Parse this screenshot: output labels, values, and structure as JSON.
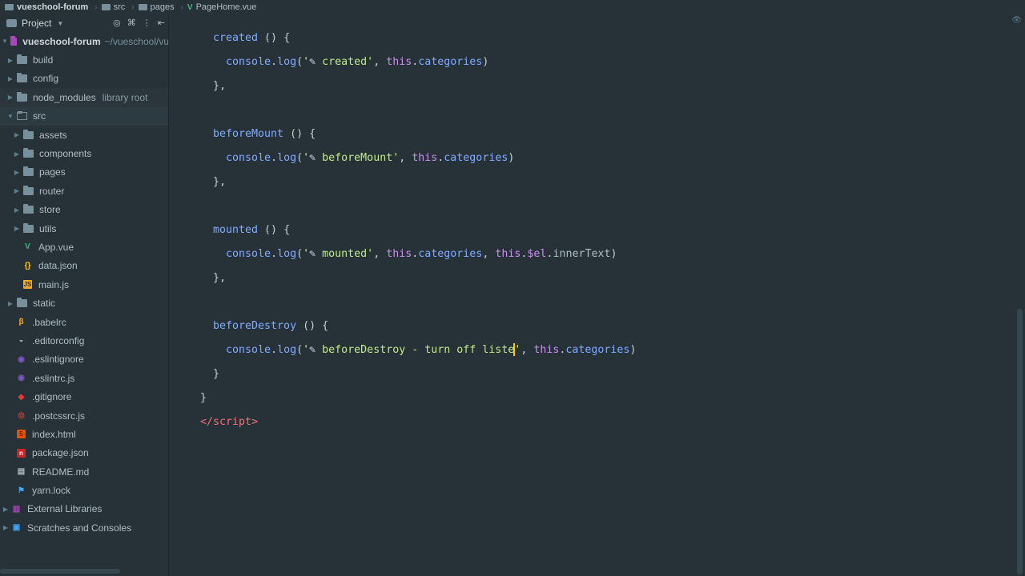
{
  "breadcrumb": [
    "vueschool-forum",
    "src",
    "pages",
    "PageHome.vue"
  ],
  "sidebar": {
    "header": "Project",
    "root": {
      "name": "vueschool-forum",
      "path": "~/vueschool/vu"
    },
    "items": [
      {
        "label": "build",
        "type": "folder",
        "depth": 1
      },
      {
        "label": "config",
        "type": "folder",
        "depth": 1
      },
      {
        "label": "node_modules",
        "extra": "library root",
        "type": "folder",
        "depth": 1
      },
      {
        "label": "src",
        "type": "folder-open",
        "depth": 1
      },
      {
        "label": "assets",
        "type": "folder",
        "depth": 2
      },
      {
        "label": "components",
        "type": "folder",
        "depth": 2
      },
      {
        "label": "pages",
        "type": "folder",
        "depth": 2
      },
      {
        "label": "router",
        "type": "folder",
        "depth": 2
      },
      {
        "label": "store",
        "type": "folder",
        "depth": 2
      },
      {
        "label": "utils",
        "type": "folder",
        "depth": 2
      },
      {
        "label": "App.vue",
        "type": "vue",
        "depth": 2
      },
      {
        "label": "data.json",
        "type": "json",
        "depth": 2
      },
      {
        "label": "main.js",
        "type": "js",
        "depth": 2
      },
      {
        "label": "static",
        "type": "folder",
        "depth": 1
      },
      {
        "label": ".babelrc",
        "type": "babel",
        "depth": 1
      },
      {
        "label": ".editorconfig",
        "type": "editorconfig",
        "depth": 1
      },
      {
        "label": ".eslintignore",
        "type": "eslint",
        "depth": 1
      },
      {
        "label": ".eslintrc.js",
        "type": "eslint",
        "depth": 1
      },
      {
        "label": ".gitignore",
        "type": "git",
        "depth": 1
      },
      {
        "label": ".postcssrc.js",
        "type": "postcss",
        "depth": 1
      },
      {
        "label": "index.html",
        "type": "html",
        "depth": 1
      },
      {
        "label": "package.json",
        "type": "npm",
        "depth": 1
      },
      {
        "label": "README.md",
        "type": "md",
        "depth": 1
      },
      {
        "label": "yarn.lock",
        "type": "yarn",
        "depth": 1
      },
      {
        "label": "External Libraries",
        "type": "lib",
        "depth": 0
      },
      {
        "label": "Scratches and Consoles",
        "type": "scratch",
        "depth": 0
      }
    ]
  },
  "editor": {
    "file": "PageHome.vue",
    "lines": [
      {
        "row": 1,
        "indent": 4,
        "tokens": [
          [
            "fn",
            "created"
          ],
          [
            "p",
            " () {"
          ]
        ]
      },
      {
        "row": 2,
        "indent": 6,
        "tokens": [
          [
            "fn",
            "console"
          ],
          [
            "p",
            "."
          ],
          [
            "fn",
            "log"
          ],
          [
            "p",
            "("
          ],
          [
            "str",
            "'"
          ],
          [
            "feather",
            "✎"
          ],
          [
            "str",
            " created'"
          ],
          [
            "p",
            ", "
          ],
          [
            "kw",
            "this"
          ],
          [
            "p",
            "."
          ],
          [
            "fn",
            "categories"
          ],
          [
            "p",
            ")"
          ]
        ]
      },
      {
        "row": 3,
        "indent": 4,
        "tokens": [
          [
            "p",
            "},"
          ]
        ]
      },
      {
        "row": 5,
        "indent": 4,
        "tokens": [
          [
            "fn",
            "beforeMount"
          ],
          [
            "p",
            " () {"
          ]
        ]
      },
      {
        "row": 6,
        "indent": 6,
        "tokens": [
          [
            "fn",
            "console"
          ],
          [
            "p",
            "."
          ],
          [
            "fn",
            "log"
          ],
          [
            "p",
            "("
          ],
          [
            "str",
            "'"
          ],
          [
            "feather",
            "✎"
          ],
          [
            "str",
            " beforeMount'"
          ],
          [
            "p",
            ", "
          ],
          [
            "kw",
            "this"
          ],
          [
            "p",
            "."
          ],
          [
            "fn",
            "categories"
          ],
          [
            "p",
            ")"
          ]
        ]
      },
      {
        "row": 7,
        "indent": 4,
        "tokens": [
          [
            "p",
            "},"
          ]
        ]
      },
      {
        "row": 9,
        "indent": 4,
        "tokens": [
          [
            "fn",
            "mounted"
          ],
          [
            "p",
            " () {"
          ]
        ]
      },
      {
        "row": 10,
        "indent": 6,
        "tokens": [
          [
            "fn",
            "console"
          ],
          [
            "p",
            "."
          ],
          [
            "fn",
            "log"
          ],
          [
            "p",
            "("
          ],
          [
            "str",
            "'"
          ],
          [
            "feather",
            "✎"
          ],
          [
            "str",
            " mounted'"
          ],
          [
            "p",
            ", "
          ],
          [
            "kw",
            "this"
          ],
          [
            "p",
            "."
          ],
          [
            "fn",
            "categories"
          ],
          [
            "p",
            ", "
          ],
          [
            "kw",
            "this"
          ],
          [
            "p",
            "."
          ],
          [
            "kw",
            "$el"
          ],
          [
            "p",
            "."
          ],
          [
            "prop",
            "innerText"
          ],
          [
            "p",
            ")"
          ]
        ]
      },
      {
        "row": 11,
        "indent": 4,
        "tokens": [
          [
            "p",
            "},"
          ]
        ]
      },
      {
        "row": 13,
        "indent": 4,
        "tokens": [
          [
            "fn",
            "beforeDestroy"
          ],
          [
            "p",
            " () {"
          ]
        ]
      },
      {
        "row": 14,
        "indent": 6,
        "tokens": [
          [
            "fn",
            "console"
          ],
          [
            "p",
            "."
          ],
          [
            "fn",
            "log"
          ],
          [
            "p",
            "("
          ],
          [
            "str",
            "'"
          ],
          [
            "feather",
            "✎"
          ],
          [
            "str",
            " beforeDestroy - turn off liste"
          ],
          [
            "cursor",
            ""
          ],
          [
            "str",
            "'"
          ],
          [
            "p",
            ", "
          ],
          [
            "kw",
            "this"
          ],
          [
            "p",
            "."
          ],
          [
            "fn",
            "categories"
          ],
          [
            "p",
            ")"
          ]
        ]
      },
      {
        "row": 15,
        "indent": 4,
        "tokens": [
          [
            "p",
            "}"
          ]
        ]
      },
      {
        "row": 16,
        "indent": 2,
        "tokens": [
          [
            "p",
            "}"
          ]
        ]
      },
      {
        "row": 17,
        "indent": 2,
        "tokens": [
          [
            "tag",
            "</"
          ],
          [
            "tag",
            "script"
          ],
          [
            "tag",
            ">"
          ]
        ]
      }
    ]
  },
  "colors": {
    "background": "#263238",
    "accent": "#ab47bc"
  }
}
